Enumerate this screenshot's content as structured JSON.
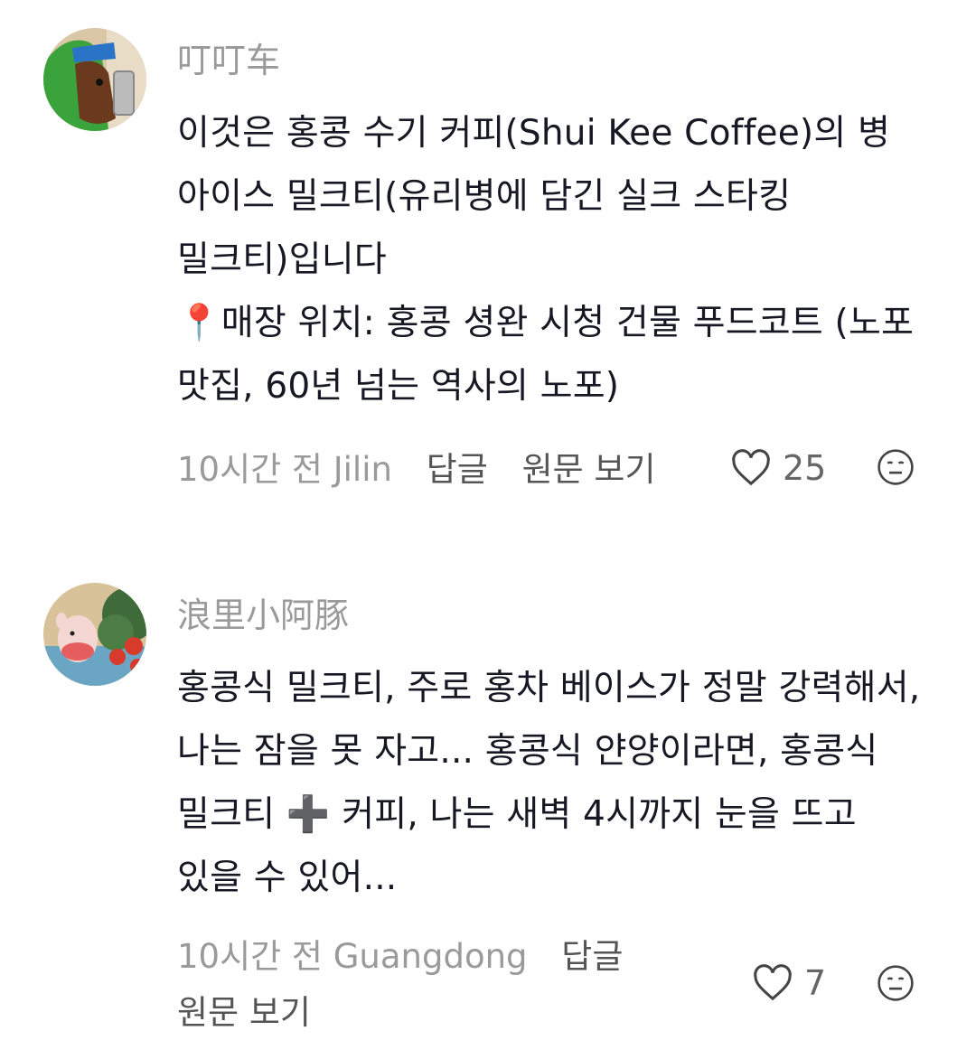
{
  "comments": [
    {
      "username": "叮叮车",
      "text": "이것은 홍콩 수기 커피(Shui Kee Coffee)의 병\n아이스 밀크티(유리병에 담긴 실크 스타킹\n밀크티)입니다\n📍매장 위치: 홍콩 셩완 시청 건물 푸드코트 (노포\n맛집, 60년 넘는 역사의 노포)",
      "time": "10시간 전",
      "location": "Jilin",
      "reply_label": "답글",
      "view_original_label": "원문 보기",
      "likes": "25",
      "avatar": "horse-avatar"
    },
    {
      "username": "浪里小阿豚",
      "text": "홍콩식 밀크티, 주로 홍차 베이스가 정말 강력해서,\n나는 잠을 못 자고... 홍콩식 얀양이라면, 홍콩식\n밀크티 ➕ 커피, 나는 새벽 4시까지 눈을 뜨고\n있을 수 있어...",
      "time": "10시간 전",
      "location": "Guangdong",
      "reply_label": "답글",
      "view_original_label": "원문 보기",
      "likes": "7",
      "avatar": "pig-avatar"
    }
  ],
  "colors": {
    "text": "#161823",
    "muted": "#9a9a9a",
    "action": "#555555"
  }
}
